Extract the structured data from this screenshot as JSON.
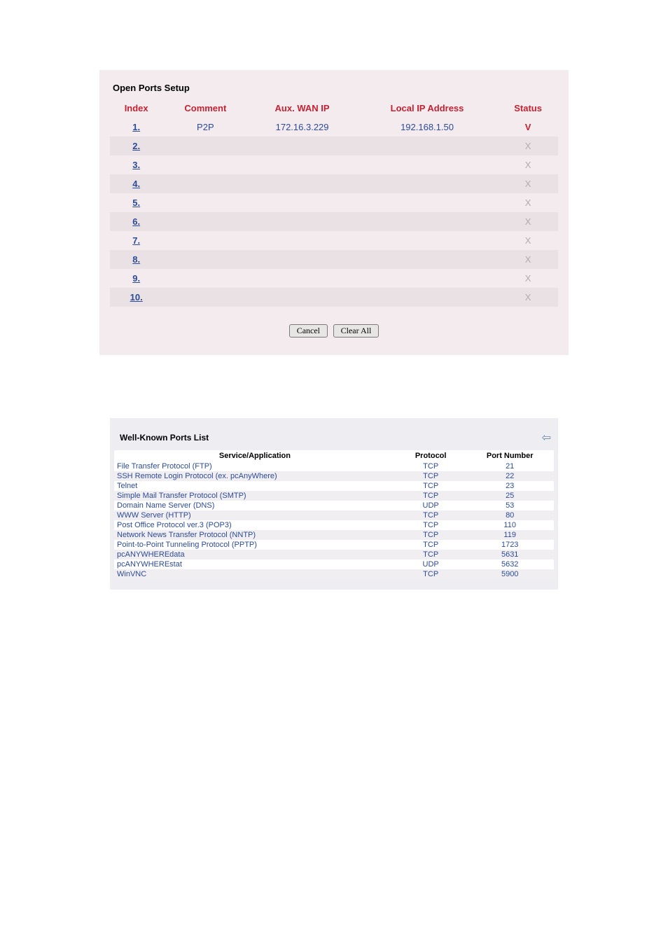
{
  "open_ports": {
    "title": "Open Ports Setup",
    "headers": {
      "index": "Index",
      "comment": "Comment",
      "aux_wan_ip": "Aux. WAN IP",
      "local_ip": "Local IP Address",
      "status": "Status"
    },
    "rows": [
      {
        "index": "1.",
        "comment": "P2P",
        "aux_wan_ip": "172.16.3.229",
        "local_ip": "192.168.1.50",
        "status": "V"
      },
      {
        "index": "2.",
        "comment": "",
        "aux_wan_ip": "",
        "local_ip": "",
        "status": "X"
      },
      {
        "index": "3.",
        "comment": "",
        "aux_wan_ip": "",
        "local_ip": "",
        "status": "X"
      },
      {
        "index": "4.",
        "comment": "",
        "aux_wan_ip": "",
        "local_ip": "",
        "status": "X"
      },
      {
        "index": "5.",
        "comment": "",
        "aux_wan_ip": "",
        "local_ip": "",
        "status": "X"
      },
      {
        "index": "6.",
        "comment": "",
        "aux_wan_ip": "",
        "local_ip": "",
        "status": "X"
      },
      {
        "index": "7.",
        "comment": "",
        "aux_wan_ip": "",
        "local_ip": "",
        "status": "X"
      },
      {
        "index": "8.",
        "comment": "",
        "aux_wan_ip": "",
        "local_ip": "",
        "status": "X"
      },
      {
        "index": "9.",
        "comment": "",
        "aux_wan_ip": "",
        "local_ip": "",
        "status": "X"
      },
      {
        "index": "10.",
        "comment": "",
        "aux_wan_ip": "",
        "local_ip": "",
        "status": "X"
      }
    ],
    "buttons": {
      "cancel": "Cancel",
      "clear_all": "Clear All"
    }
  },
  "well_known": {
    "title": "Well-Known Ports List",
    "headers": {
      "service": "Service/Application",
      "protocol": "Protocol",
      "port": "Port Number"
    },
    "rows": [
      {
        "service": "File Transfer Protocol (FTP)",
        "protocol": "TCP",
        "port": "21"
      },
      {
        "service": "SSH Remote Login Protocol (ex. pcAnyWhere)",
        "protocol": "TCP",
        "port": "22"
      },
      {
        "service": "Telnet",
        "protocol": "TCP",
        "port": "23"
      },
      {
        "service": "Simple Mail Transfer Protocol (SMTP)",
        "protocol": "TCP",
        "port": "25"
      },
      {
        "service": "Domain Name Server (DNS)",
        "protocol": "UDP",
        "port": "53"
      },
      {
        "service": "WWW Server (HTTP)",
        "protocol": "TCP",
        "port": "80"
      },
      {
        "service": "Post Office Protocol ver.3 (POP3)",
        "protocol": "TCP",
        "port": "110"
      },
      {
        "service": "Network News Transfer Protocol (NNTP)",
        "protocol": "TCP",
        "port": "119"
      },
      {
        "service": "Point-to-Point Tunneling Protocol (PPTP)",
        "protocol": "TCP",
        "port": "1723"
      },
      {
        "service": "pcANYWHEREdata",
        "protocol": "TCP",
        "port": "5631"
      },
      {
        "service": "pcANYWHEREstat",
        "protocol": "UDP",
        "port": "5632"
      },
      {
        "service": "WinVNC",
        "protocol": "TCP",
        "port": "5900"
      }
    ]
  }
}
